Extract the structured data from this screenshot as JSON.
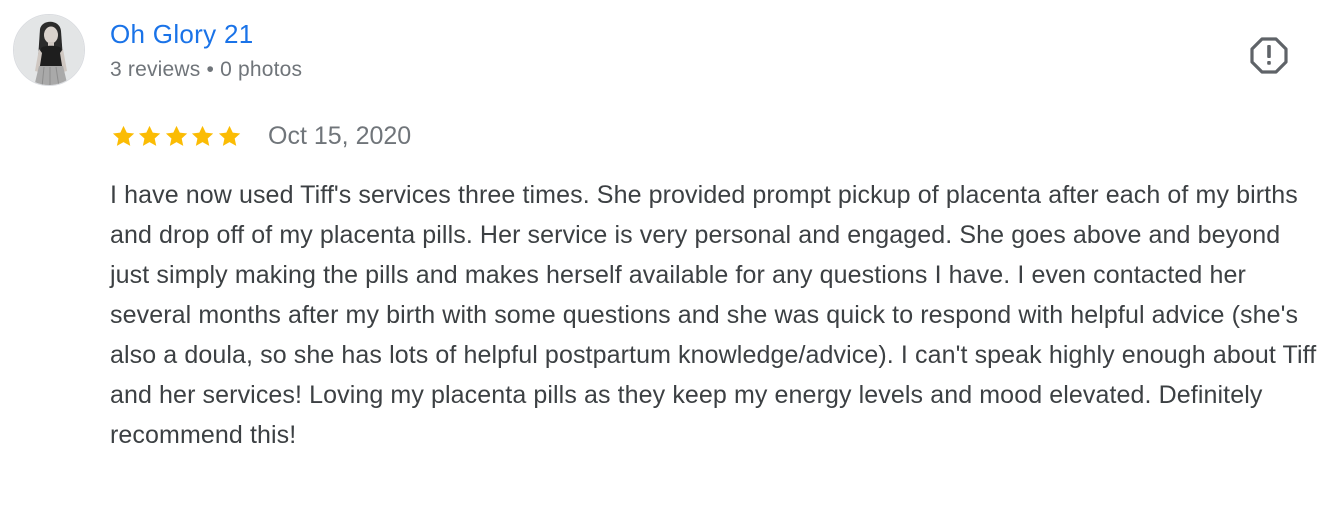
{
  "reviewer": {
    "name": "Oh Glory 21",
    "reviews_count": "3 reviews",
    "separator": "•",
    "photos_count": "0 photos"
  },
  "review": {
    "rating": 5,
    "rating_max": 5,
    "date": "Oct 15, 2020",
    "text": "I have now used Tiff's services three times. She provided prompt pickup of placenta after each of my births and drop off of my placenta pills. Her service is very personal and engaged. She goes above and beyond just simply making the pills and makes herself available for any questions I have. I even contacted her several months after my birth with some questions and she was quick to respond with helpful advice (she's also a doula, so she has lots of helpful postpartum knowledge/advice). I can't speak highly enough about Tiff and her services! Loving my placenta pills as they keep my energy levels and mood elevated. Definitely recommend this!"
  },
  "icons": {
    "report": "report-flag-octagon-icon",
    "star": "star-icon",
    "avatar": "avatar-photo"
  },
  "colors": {
    "name_link": "#1a73e8",
    "meta_text": "#70757a",
    "body_text": "#3c4043",
    "star_fill": "#fbbc04",
    "icon": "#5f6368"
  }
}
